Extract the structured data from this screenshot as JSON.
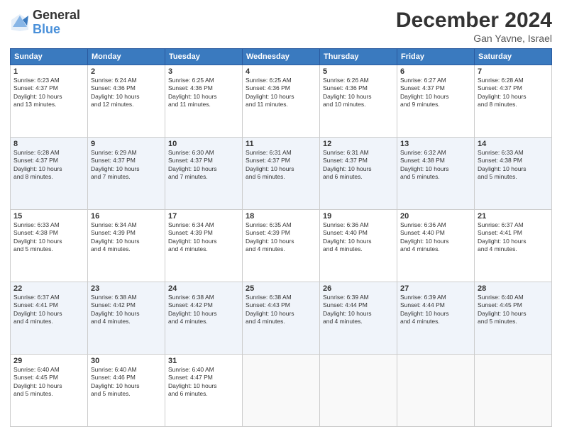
{
  "logo": {
    "general": "General",
    "blue": "Blue"
  },
  "title": "December 2024",
  "location": "Gan Yavne, Israel",
  "days_of_week": [
    "Sunday",
    "Monday",
    "Tuesday",
    "Wednesday",
    "Thursday",
    "Friday",
    "Saturday"
  ],
  "weeks": [
    [
      {
        "day": "1",
        "info": "Sunrise: 6:23 AM\nSunset: 4:37 PM\nDaylight: 10 hours\nand 13 minutes."
      },
      {
        "day": "2",
        "info": "Sunrise: 6:24 AM\nSunset: 4:36 PM\nDaylight: 10 hours\nand 12 minutes."
      },
      {
        "day": "3",
        "info": "Sunrise: 6:25 AM\nSunset: 4:36 PM\nDaylight: 10 hours\nand 11 minutes."
      },
      {
        "day": "4",
        "info": "Sunrise: 6:25 AM\nSunset: 4:36 PM\nDaylight: 10 hours\nand 11 minutes."
      },
      {
        "day": "5",
        "info": "Sunrise: 6:26 AM\nSunset: 4:36 PM\nDaylight: 10 hours\nand 10 minutes."
      },
      {
        "day": "6",
        "info": "Sunrise: 6:27 AM\nSunset: 4:37 PM\nDaylight: 10 hours\nand 9 minutes."
      },
      {
        "day": "7",
        "info": "Sunrise: 6:28 AM\nSunset: 4:37 PM\nDaylight: 10 hours\nand 8 minutes."
      }
    ],
    [
      {
        "day": "8",
        "info": "Sunrise: 6:28 AM\nSunset: 4:37 PM\nDaylight: 10 hours\nand 8 minutes."
      },
      {
        "day": "9",
        "info": "Sunrise: 6:29 AM\nSunset: 4:37 PM\nDaylight: 10 hours\nand 7 minutes."
      },
      {
        "day": "10",
        "info": "Sunrise: 6:30 AM\nSunset: 4:37 PM\nDaylight: 10 hours\nand 7 minutes."
      },
      {
        "day": "11",
        "info": "Sunrise: 6:31 AM\nSunset: 4:37 PM\nDaylight: 10 hours\nand 6 minutes."
      },
      {
        "day": "12",
        "info": "Sunrise: 6:31 AM\nSunset: 4:37 PM\nDaylight: 10 hours\nand 6 minutes."
      },
      {
        "day": "13",
        "info": "Sunrise: 6:32 AM\nSunset: 4:38 PM\nDaylight: 10 hours\nand 5 minutes."
      },
      {
        "day": "14",
        "info": "Sunrise: 6:33 AM\nSunset: 4:38 PM\nDaylight: 10 hours\nand 5 minutes."
      }
    ],
    [
      {
        "day": "15",
        "info": "Sunrise: 6:33 AM\nSunset: 4:38 PM\nDaylight: 10 hours\nand 5 minutes."
      },
      {
        "day": "16",
        "info": "Sunrise: 6:34 AM\nSunset: 4:39 PM\nDaylight: 10 hours\nand 4 minutes."
      },
      {
        "day": "17",
        "info": "Sunrise: 6:34 AM\nSunset: 4:39 PM\nDaylight: 10 hours\nand 4 minutes."
      },
      {
        "day": "18",
        "info": "Sunrise: 6:35 AM\nSunset: 4:39 PM\nDaylight: 10 hours\nand 4 minutes."
      },
      {
        "day": "19",
        "info": "Sunrise: 6:36 AM\nSunset: 4:40 PM\nDaylight: 10 hours\nand 4 minutes."
      },
      {
        "day": "20",
        "info": "Sunrise: 6:36 AM\nSunset: 4:40 PM\nDaylight: 10 hours\nand 4 minutes."
      },
      {
        "day": "21",
        "info": "Sunrise: 6:37 AM\nSunset: 4:41 PM\nDaylight: 10 hours\nand 4 minutes."
      }
    ],
    [
      {
        "day": "22",
        "info": "Sunrise: 6:37 AM\nSunset: 4:41 PM\nDaylight: 10 hours\nand 4 minutes."
      },
      {
        "day": "23",
        "info": "Sunrise: 6:38 AM\nSunset: 4:42 PM\nDaylight: 10 hours\nand 4 minutes."
      },
      {
        "day": "24",
        "info": "Sunrise: 6:38 AM\nSunset: 4:42 PM\nDaylight: 10 hours\nand 4 minutes."
      },
      {
        "day": "25",
        "info": "Sunrise: 6:38 AM\nSunset: 4:43 PM\nDaylight: 10 hours\nand 4 minutes."
      },
      {
        "day": "26",
        "info": "Sunrise: 6:39 AM\nSunset: 4:44 PM\nDaylight: 10 hours\nand 4 minutes."
      },
      {
        "day": "27",
        "info": "Sunrise: 6:39 AM\nSunset: 4:44 PM\nDaylight: 10 hours\nand 4 minutes."
      },
      {
        "day": "28",
        "info": "Sunrise: 6:40 AM\nSunset: 4:45 PM\nDaylight: 10 hours\nand 5 minutes."
      }
    ],
    [
      {
        "day": "29",
        "info": "Sunrise: 6:40 AM\nSunset: 4:45 PM\nDaylight: 10 hours\nand 5 minutes."
      },
      {
        "day": "30",
        "info": "Sunrise: 6:40 AM\nSunset: 4:46 PM\nDaylight: 10 hours\nand 5 minutes."
      },
      {
        "day": "31",
        "info": "Sunrise: 6:40 AM\nSunset: 4:47 PM\nDaylight: 10 hours\nand 6 minutes."
      },
      {
        "day": "",
        "info": ""
      },
      {
        "day": "",
        "info": ""
      },
      {
        "day": "",
        "info": ""
      },
      {
        "day": "",
        "info": ""
      }
    ]
  ]
}
